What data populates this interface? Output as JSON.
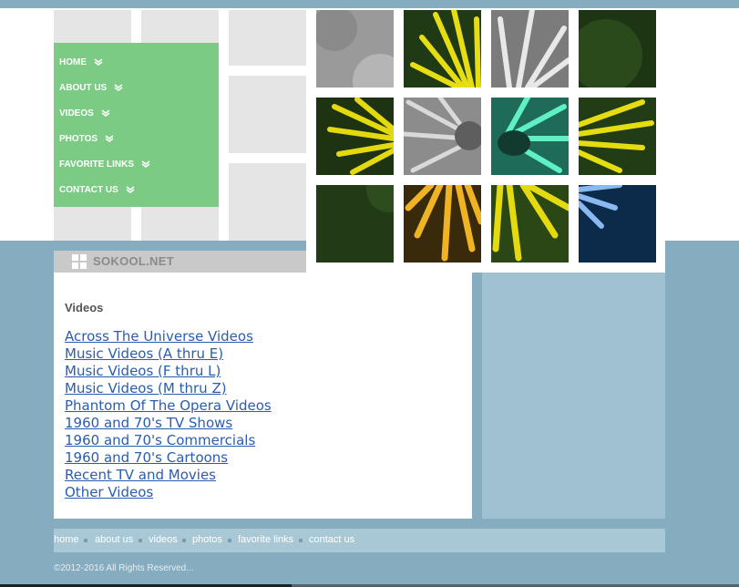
{
  "nav": {
    "items": [
      {
        "label": "HOME"
      },
      {
        "label": "ABOUT US"
      },
      {
        "label": "VIDEOS"
      },
      {
        "label": "PHOTOS"
      },
      {
        "label": "FAVORITE LINKS"
      },
      {
        "label": "CONTACT US"
      }
    ]
  },
  "logo": {
    "text": "SOKOOL.NET"
  },
  "main": {
    "heading": "Videos",
    "links": [
      {
        "label": "Across The Universe Videos"
      },
      {
        "label": "Music Videos (A thru E)"
      },
      {
        "label": "Music Videos (F thru L)"
      },
      {
        "label": "Music Videos (M thru Z)"
      },
      {
        "label": "Phantom Of The Opera Videos"
      },
      {
        "label": "1960 and 70's TV Shows"
      },
      {
        "label": "1960 and 70's Commercials"
      },
      {
        "label": "1960 and 70's Cartoons"
      },
      {
        "label": "Recent TV and Movies"
      },
      {
        "label": "Other Videos"
      }
    ]
  },
  "footer": {
    "links": [
      {
        "label": "home"
      },
      {
        "label": "about us"
      },
      {
        "label": "videos"
      },
      {
        "label": "photos"
      },
      {
        "label": "favorite links"
      },
      {
        "label": "contact us"
      }
    ],
    "copyright": "©2012-2016 All Rights Reserved..."
  },
  "colors": {
    "nav_bg": "#7ccb85",
    "page_blue": "#86acbf",
    "link_blue": "#2a5db0",
    "sidebox": "#a0c1d2"
  }
}
